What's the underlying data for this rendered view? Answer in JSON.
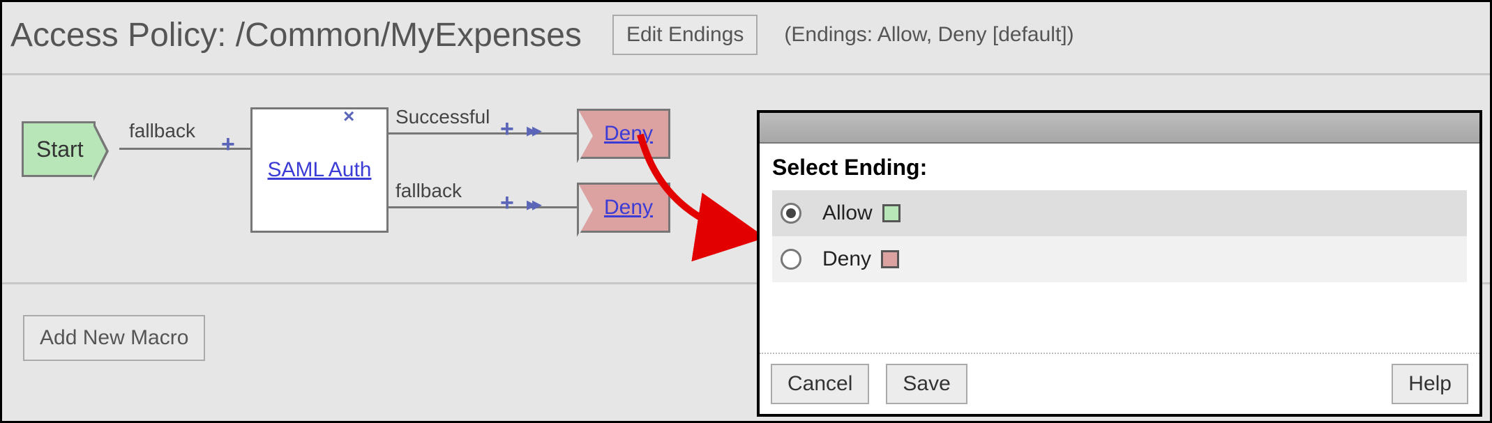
{
  "header": {
    "title": "Access Policy: /Common/MyExpenses",
    "edit_endings": "Edit Endings",
    "endings_note": "(Endings: Allow, Deny [default])"
  },
  "flow": {
    "start_label": "Start",
    "saml_label": "SAML Auth",
    "edge_fallback1": "fallback",
    "edge_successful": "Successful",
    "edge_fallback2": "fallback",
    "deny1_label": "Deny",
    "deny2_label": "Deny"
  },
  "macro": {
    "add_macro": "Add New Macro"
  },
  "dialog": {
    "heading": "Select Ending:",
    "option_allow": "Allow",
    "option_deny": "Deny",
    "cancel": "Cancel",
    "save": "Save",
    "help": "Help"
  }
}
